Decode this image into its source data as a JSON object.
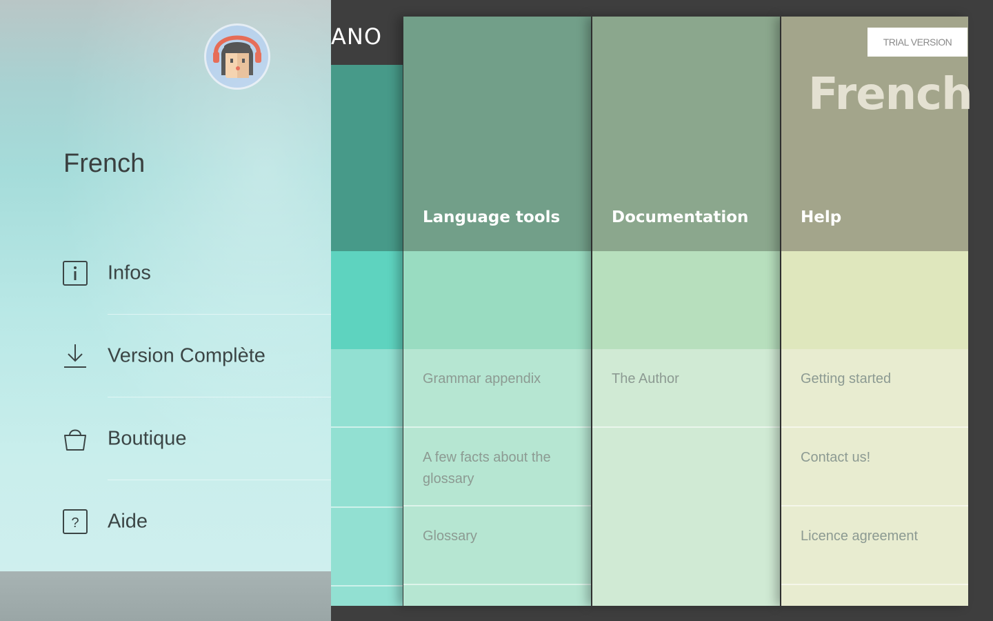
{
  "app": {
    "logo_text": "ANO",
    "trial_badge": "TRIAL VERSION",
    "language_heading": "French"
  },
  "colors": {
    "left_strip_head": "#479a89",
    "left_strip_band": "#5ed3bf",
    "left_strip_body": "#92e0d2",
    "col1_head": "#729f89",
    "col1_band": "#99dcc1",
    "col1_body": "#b6e6d2",
    "col2_head": "#8ba78d",
    "col2_band": "#b7dfbd",
    "col2_body": "#d0ead4",
    "col3_head": "#a3a58b",
    "col3_band": "#dfe7bd",
    "col3_body": "#e8ecd0"
  },
  "columns": [
    {
      "title": "Language tools",
      "items": [
        "Grammar appendix",
        "A few facts about the glossary",
        "Glossary"
      ]
    },
    {
      "title": "Documentation",
      "items": [
        "The Author",
        "",
        ""
      ]
    },
    {
      "title": "Help",
      "items": [
        "Getting started",
        "Contact us!",
        "Licence agreement"
      ]
    }
  ],
  "drawer": {
    "title": "French",
    "avatar_icon": "avatar-girl-icon",
    "menu": [
      {
        "label": "Infos",
        "icon": "info-icon"
      },
      {
        "label": "Version Complète",
        "icon": "download-icon"
      },
      {
        "label": "Boutique",
        "icon": "basket-icon"
      },
      {
        "label": "Aide",
        "icon": "help-icon"
      }
    ]
  }
}
